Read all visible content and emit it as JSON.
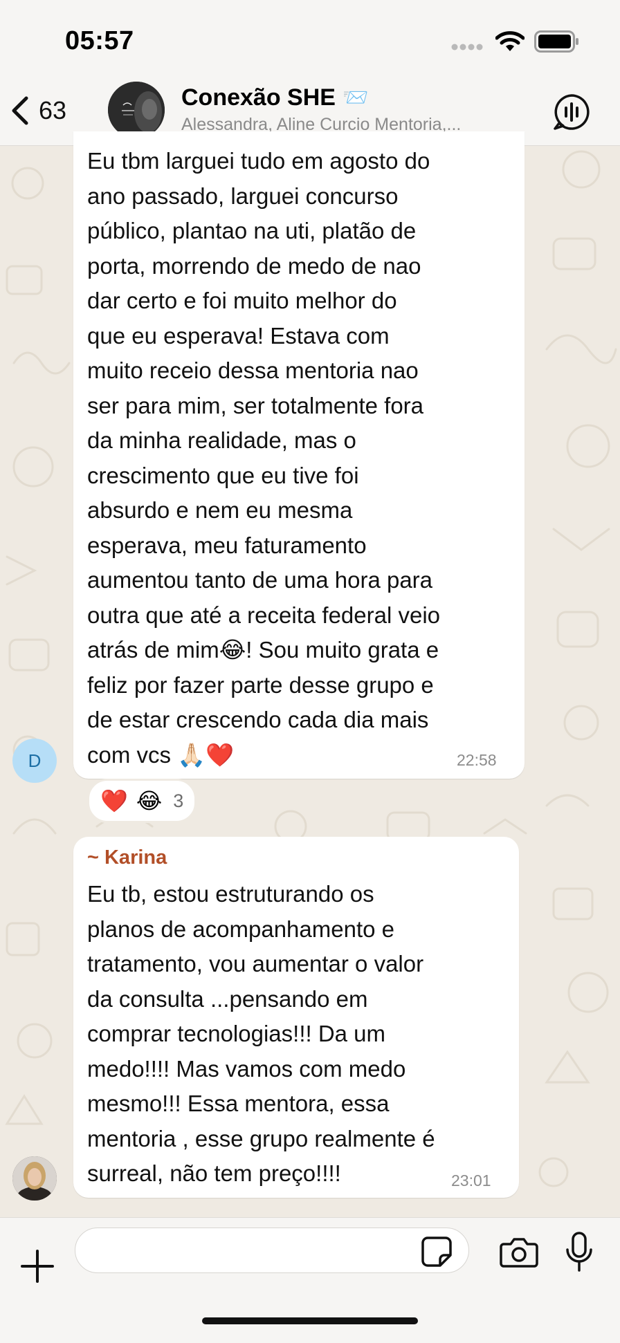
{
  "status_bar": {
    "time": "05:57"
  },
  "header": {
    "back_count": "63",
    "group_name": "Conexão SHE",
    "group_emoji": "📨",
    "members": "Alessandra, Aline Curcio Mentoria,...",
    "icons": [
      "chevron-left-icon",
      "voice-chat-icon"
    ]
  },
  "messages": [
    {
      "avatar_initial": "D",
      "text": "Eu tbm larguei tudo em agosto do\nano passado, larguei concurso\npúblico, plantao na uti, platão de\nporta, morrendo de medo de nao\ndar certo e foi muito melhor do\nque eu esperava! Estava com\nmuito receio dessa mentoria nao\nser para mim, ser totalmente fora\nda minha realidade, mas o\ncrescimento que eu tive foi\nabsurdo e nem eu mesma\nesperava, meu faturamento\naumentou tanto de uma hora para\noutra que até a receita federal veio\natrás de mim😂! Sou muito grata e\nfeliz por fazer parte desse grupo e\nde estar crescendo cada dia mais\ncom vcs 🙏🏻❤️",
      "time": "22:58",
      "reactions": {
        "emojis": [
          "❤️",
          "😂"
        ],
        "count": "3"
      }
    },
    {
      "sender": "~ Karina",
      "text": "Eu  tb, estou estruturando os\nplanos de acompanhamento e\ntratamento, vou aumentar o valor\nda consulta ...pensando em\ncomprar tecnologias!!! Da um\nmedo!!!! Mas vamos com medo\nmesmo!!! Essa mentora, essa\nmentoria , esse grupo realmente é\nsurreal, não tem preço!!!!",
      "time": "23:01"
    }
  ],
  "input": {
    "placeholder": "",
    "value": ""
  },
  "colors": {
    "chat_background": "#efeae2",
    "bubble": "#ffffff",
    "sender_name": "#b24f28",
    "avatar_initial_bg": "#b6def7"
  }
}
